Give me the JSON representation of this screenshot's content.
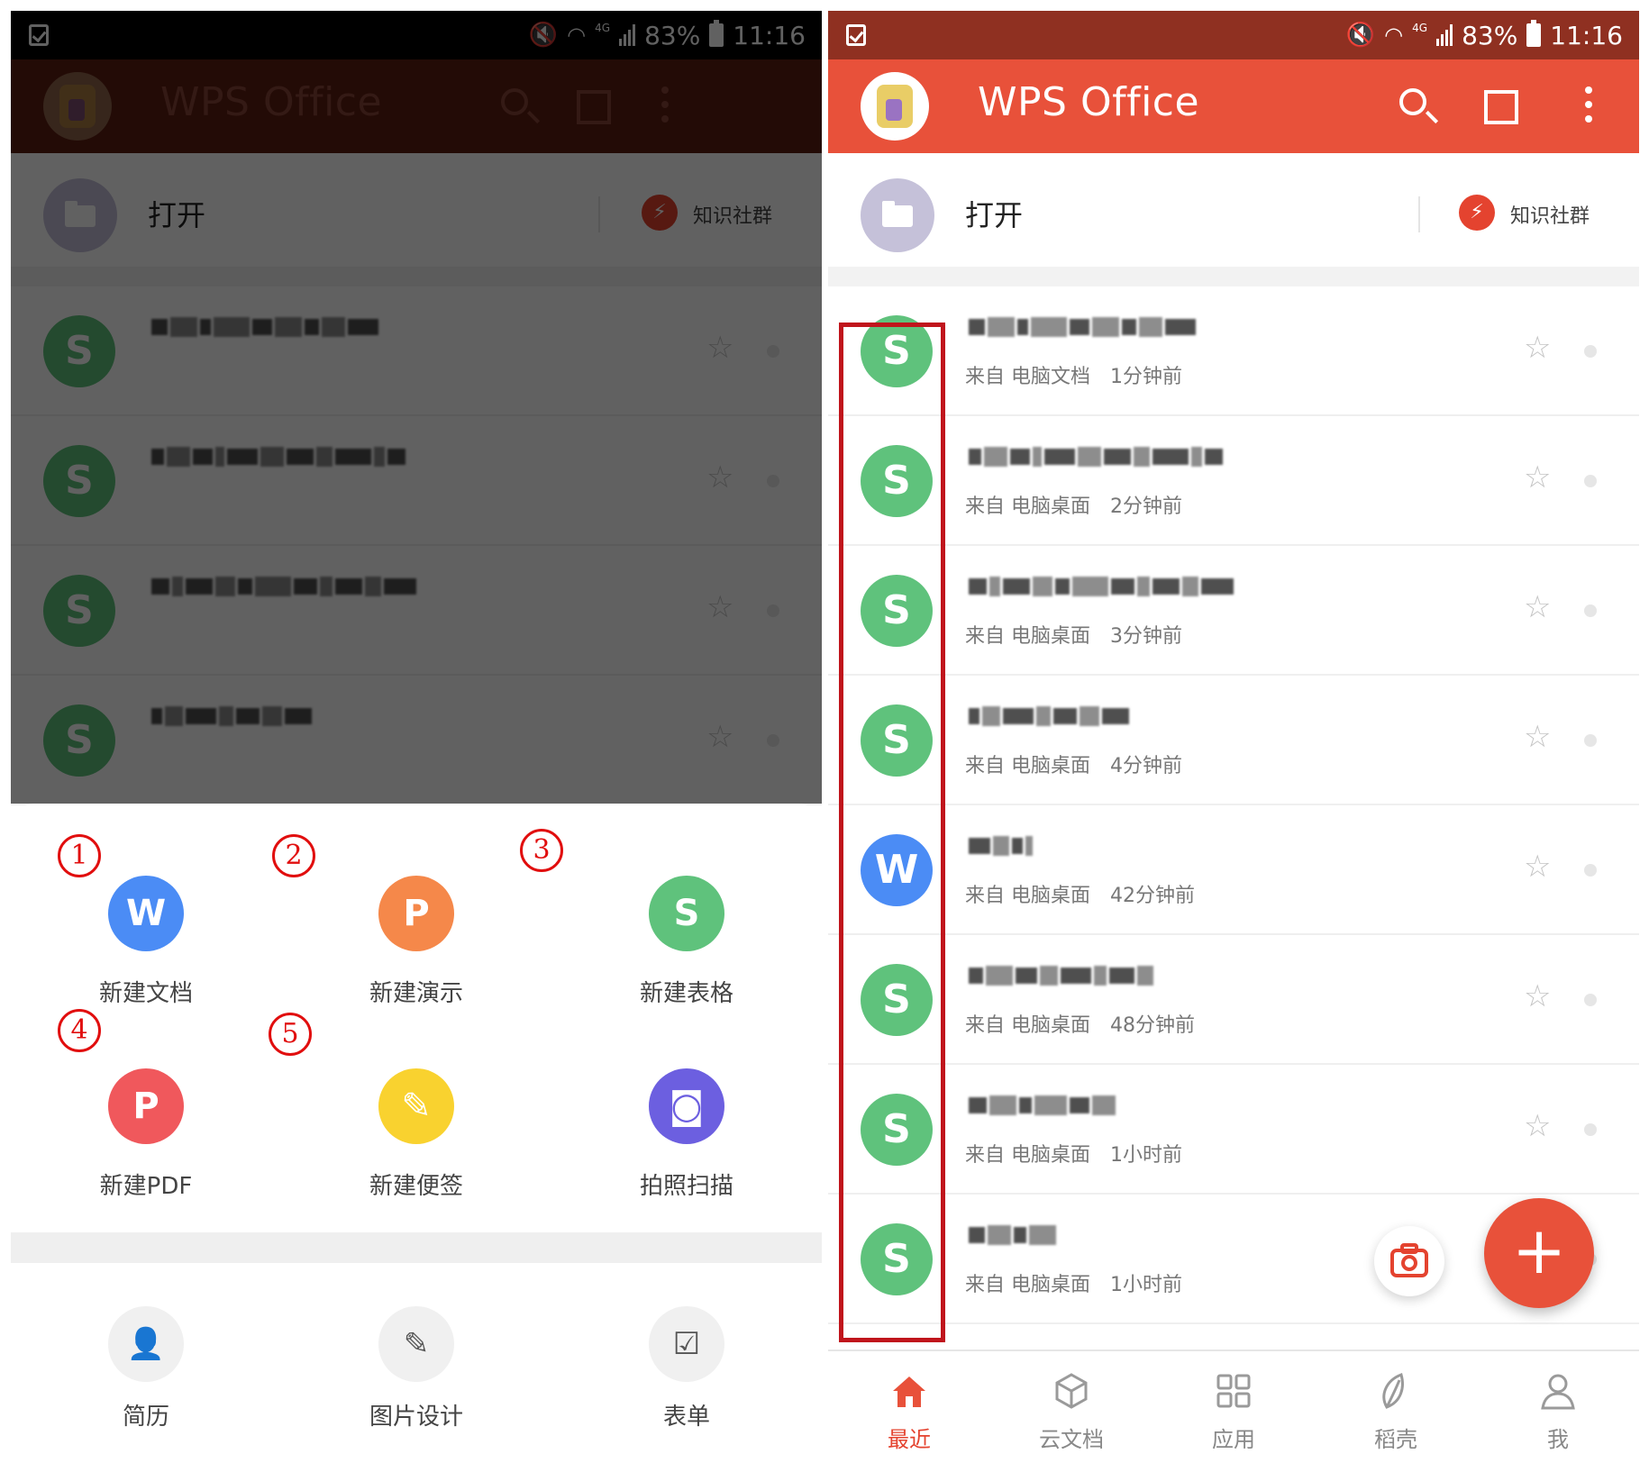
{
  "status_bar": {
    "battery": "83%",
    "time": "11:16",
    "network": "4G"
  },
  "app": {
    "title": "WPS Office"
  },
  "open_row": {
    "open_label": "打开",
    "community_label": "知识社群"
  },
  "files": [
    {
      "type": "S",
      "source": "来自 电脑文档",
      "time": "1分钟前"
    },
    {
      "type": "S",
      "source": "来自 电脑桌面",
      "time": "2分钟前"
    },
    {
      "type": "S",
      "source": "来自 电脑桌面",
      "time": "3分钟前"
    },
    {
      "type": "S",
      "source": "来自 电脑桌面",
      "time": "4分钟前"
    },
    {
      "type": "W",
      "source": "来自 电脑桌面",
      "time": "42分钟前"
    },
    {
      "type": "S",
      "source": "来自 电脑桌面",
      "time": "48分钟前"
    },
    {
      "type": "S",
      "source": "来自 电脑桌面",
      "time": "1小时前"
    },
    {
      "type": "S",
      "source": "来自 电脑桌面",
      "time": "1小时前"
    }
  ],
  "new_actions": [
    {
      "number": "1",
      "label": "新建文档",
      "letter": "W",
      "color": "#4b8cf5"
    },
    {
      "number": "2",
      "label": "新建演示",
      "letter": "P",
      "color": "#f5884a"
    },
    {
      "number": "3",
      "label": "新建表格",
      "letter": "S",
      "color": "#5fc27c"
    },
    {
      "number": "4",
      "label": "新建PDF",
      "letter": "P",
      "color": "#f0585c"
    },
    {
      "number": "5",
      "label": "新建便签",
      "letter": "✎",
      "color": "#f9d22f"
    },
    {
      "number": "",
      "label": "拍照扫描",
      "letter": "◙",
      "color": "#6c5fe0"
    }
  ],
  "templates": [
    {
      "label": "简历",
      "icon": "resume-icon"
    },
    {
      "label": "图片设计",
      "icon": "image-design-icon"
    },
    {
      "label": "表单",
      "icon": "form-icon"
    }
  ],
  "tabs": [
    {
      "label": "最近",
      "icon": "home-icon",
      "active": true
    },
    {
      "label": "云文档",
      "icon": "cloud-doc-icon",
      "active": false
    },
    {
      "label": "应用",
      "icon": "apps-icon",
      "active": false
    },
    {
      "label": "稻壳",
      "icon": "leaf-icon",
      "active": false
    },
    {
      "label": "我",
      "icon": "profile-icon",
      "active": false
    }
  ],
  "colors": {
    "accent": "#e8513a",
    "highlight": "#c0151c",
    "sheet_annotation": "#e10e0e"
  }
}
